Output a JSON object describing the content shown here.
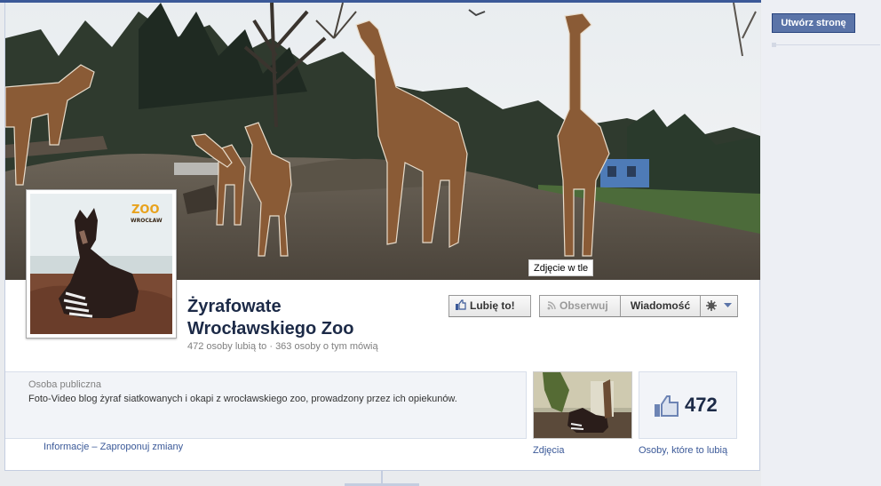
{
  "right_column": {
    "create_page_button": "Utwórz stronę"
  },
  "cover": {
    "tooltip": "Zdjęcie w tle"
  },
  "page": {
    "name_line1": "Żyrafowate",
    "name_line2": "Wrocławskiego Zoo",
    "stats": "472 osoby lubią to · 363 osoby o tym mówią",
    "profile_logo_top": "ZOO",
    "profile_logo_bottom": "WROCŁAW"
  },
  "actions": {
    "like_label": "Lubię to!",
    "follow_label": "Obserwuj",
    "message_label": "Wiadomość",
    "settings_icon": "gear-icon",
    "dropdown_icon": "caret-down-icon"
  },
  "about": {
    "category": "Osoba publiczna",
    "description": "Foto-Video blog żyraf siatkowanych i okapi z wrocławskiego zoo, prowadzony przez ich opiekunów.",
    "link_info": "Informacje",
    "link_separator": "–",
    "link_suggest": "Zaproponuj zmiany"
  },
  "apps": {
    "photos_label": "Zdjęcia",
    "likes_count": "472",
    "likes_label": "Osoby, które to lubią"
  },
  "colors": {
    "brand": "#3b5998",
    "page_name": "#1c2a47",
    "background": "#e9ebee"
  }
}
